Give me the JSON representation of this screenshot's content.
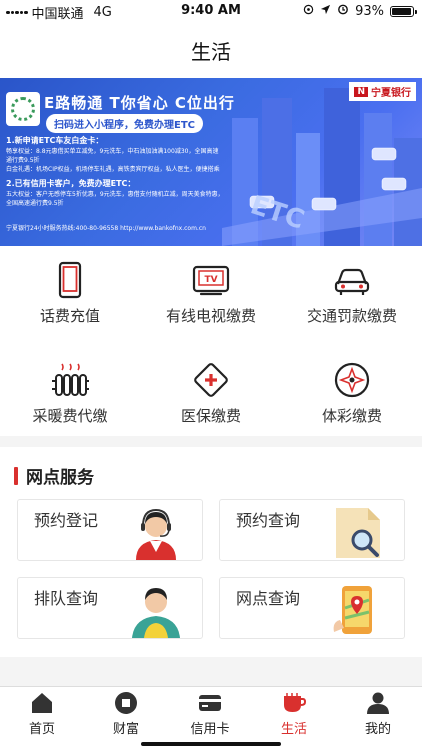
{
  "status_bar": {
    "carrier": "中国联通",
    "network": "4G",
    "time": "9:40 AM",
    "battery": "93%",
    "battery_level": 0.93
  },
  "nav": {
    "title": "生活"
  },
  "banner": {
    "slogan": "E路畅通 T你省心 C位出行",
    "pill": "扫码进入小程序，免费办理ETC",
    "bank_name": "宁夏银行",
    "heading1": "1.新申请ETC车友白金卡：",
    "line1a": "畅享权益：8.8元惠借买单立减免，9元洗车，中石油加油满100减30，全国高速",
    "line1b": "通行费9.5折",
    "line1c": "白金礼遇：机场CIP权益，机场停车礼遇，高铁贵宾厅权益，私人医生，便捷搭乘",
    "heading2": "2.已有信用卡客户，免费办理ETC：",
    "line2a": "五大权益：客户无感停车5折优惠，9元洗车，惠借支付随机立减，周天美食特惠，",
    "line2b": "全国高速通行费9.5折",
    "footer": "宁夏银行24小时服务热线:400-80-96558       http://www.bankofnx.com.cn",
    "etc_mark": "ETC"
  },
  "services": [
    {
      "label": "话费充值",
      "icon": "phone-icon"
    },
    {
      "label": "有线电视缴费",
      "icon": "tv-icon"
    },
    {
      "label": "交通罚款缴费",
      "icon": "car-icon"
    },
    {
      "label": "采暖费代缴",
      "icon": "radiator-icon"
    },
    {
      "label": "医保缴费",
      "icon": "medical-icon"
    },
    {
      "label": "体彩缴费",
      "icon": "lottery-icon"
    }
  ],
  "branch": {
    "title": "网点服务",
    "cards": [
      {
        "label": "预约登记",
        "icon": "headset-agent-icon"
      },
      {
        "label": "预约查询",
        "icon": "document-search-icon"
      },
      {
        "label": "排队查询",
        "icon": "person-icon"
      },
      {
        "label": "网点查询",
        "icon": "map-phone-icon"
      }
    ]
  },
  "tabs": [
    {
      "label": "首页",
      "icon": "home-icon",
      "active": false
    },
    {
      "label": "财富",
      "icon": "wealth-icon",
      "active": false
    },
    {
      "label": "信用卡",
      "icon": "credit-card-icon",
      "active": false
    },
    {
      "label": "生活",
      "icon": "cup-icon",
      "active": true
    },
    {
      "label": "我的",
      "icon": "user-icon",
      "active": false
    }
  ],
  "colors": {
    "accent": "#d9302e",
    "banner_blue": "#3a6be0"
  }
}
